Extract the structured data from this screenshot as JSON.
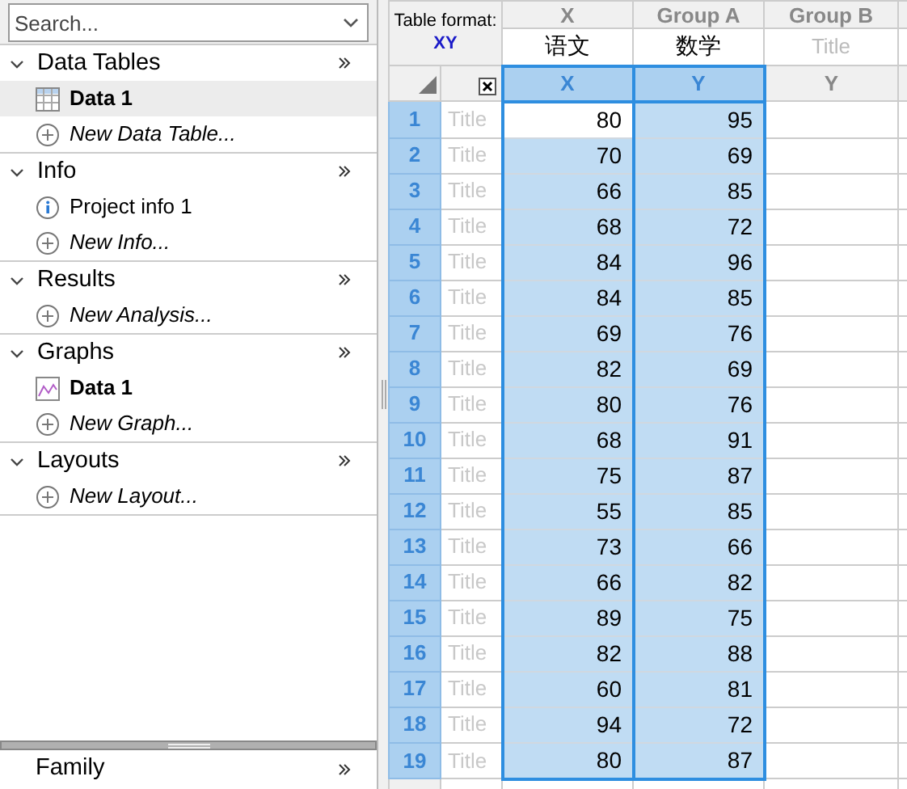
{
  "sidebar": {
    "search": {
      "placeholder": "Search..."
    },
    "sections": [
      {
        "title": "Data Tables",
        "expanded": true,
        "items": [
          {
            "kind": "table",
            "label": "Data 1",
            "selected": true
          },
          {
            "kind": "add",
            "label": "New Data Table...",
            "selected": false
          }
        ]
      },
      {
        "title": "Info",
        "expanded": true,
        "items": [
          {
            "kind": "info",
            "label": "Project info 1",
            "selected": false
          },
          {
            "kind": "add",
            "label": "New Info...",
            "selected": false
          }
        ]
      },
      {
        "title": "Results",
        "expanded": true,
        "items": [
          {
            "kind": "add",
            "label": "New Analysis...",
            "selected": false
          }
        ]
      },
      {
        "title": "Graphs",
        "expanded": true,
        "items": [
          {
            "kind": "graph",
            "label": "Data 1",
            "selected": false
          },
          {
            "kind": "add",
            "label": "New Graph...",
            "selected": false
          }
        ]
      },
      {
        "title": "Layouts",
        "expanded": true,
        "items": [
          {
            "kind": "add",
            "label": "New Layout...",
            "selected": false
          }
        ]
      }
    ],
    "bottom_section": {
      "title": "Family"
    }
  },
  "table": {
    "format_label": "Table format:",
    "format": "XY",
    "columns": [
      {
        "group": "X",
        "title": "语文",
        "title_placeholder": false,
        "subheader": "X",
        "selected": true
      },
      {
        "group": "Group A",
        "title": "数学",
        "title_placeholder": false,
        "subheader": "Y",
        "selected": true
      },
      {
        "group": "Group B",
        "title": "Title",
        "title_placeholder": true,
        "subheader": "Y",
        "selected": false
      }
    ],
    "rows": [
      {
        "number": "1",
        "title": "Title",
        "selected": true,
        "cells": [
          {
            "value": "80",
            "active": true
          },
          {
            "value": "95",
            "active": false
          }
        ]
      },
      {
        "number": "2",
        "title": "Title",
        "selected": true,
        "cells": [
          {
            "value": "70",
            "active": false
          },
          {
            "value": "69",
            "active": false
          }
        ]
      },
      {
        "number": "3",
        "title": "Title",
        "selected": true,
        "cells": [
          {
            "value": "66",
            "active": false
          },
          {
            "value": "85",
            "active": false
          }
        ]
      },
      {
        "number": "4",
        "title": "Title",
        "selected": true,
        "cells": [
          {
            "value": "68",
            "active": false
          },
          {
            "value": "72",
            "active": false
          }
        ]
      },
      {
        "number": "5",
        "title": "Title",
        "selected": true,
        "cells": [
          {
            "value": "84",
            "active": false
          },
          {
            "value": "96",
            "active": false
          }
        ]
      },
      {
        "number": "6",
        "title": "Title",
        "selected": true,
        "cells": [
          {
            "value": "84",
            "active": false
          },
          {
            "value": "85",
            "active": false
          }
        ]
      },
      {
        "number": "7",
        "title": "Title",
        "selected": true,
        "cells": [
          {
            "value": "69",
            "active": false
          },
          {
            "value": "76",
            "active": false
          }
        ]
      },
      {
        "number": "8",
        "title": "Title",
        "selected": true,
        "cells": [
          {
            "value": "82",
            "active": false
          },
          {
            "value": "69",
            "active": false
          }
        ]
      },
      {
        "number": "9",
        "title": "Title",
        "selected": true,
        "cells": [
          {
            "value": "80",
            "active": false
          },
          {
            "value": "76",
            "active": false
          }
        ]
      },
      {
        "number": "10",
        "title": "Title",
        "selected": true,
        "cells": [
          {
            "value": "68",
            "active": false
          },
          {
            "value": "91",
            "active": false
          }
        ]
      },
      {
        "number": "11",
        "title": "Title",
        "selected": true,
        "cells": [
          {
            "value": "75",
            "active": false
          },
          {
            "value": "87",
            "active": false
          }
        ]
      },
      {
        "number": "12",
        "title": "Title",
        "selected": true,
        "cells": [
          {
            "value": "55",
            "active": false
          },
          {
            "value": "85",
            "active": false
          }
        ]
      },
      {
        "number": "13",
        "title": "Title",
        "selected": true,
        "cells": [
          {
            "value": "73",
            "active": false
          },
          {
            "value": "66",
            "active": false
          }
        ]
      },
      {
        "number": "14",
        "title": "Title",
        "selected": true,
        "cells": [
          {
            "value": "66",
            "active": false
          },
          {
            "value": "82",
            "active": false
          }
        ]
      },
      {
        "number": "15",
        "title": "Title",
        "selected": true,
        "cells": [
          {
            "value": "89",
            "active": false
          },
          {
            "value": "75",
            "active": false
          }
        ]
      },
      {
        "number": "16",
        "title": "Title",
        "selected": true,
        "cells": [
          {
            "value": "82",
            "active": false
          },
          {
            "value": "88",
            "active": false
          }
        ]
      },
      {
        "number": "17",
        "title": "Title",
        "selected": true,
        "cells": [
          {
            "value": "60",
            "active": false
          },
          {
            "value": "81",
            "active": false
          }
        ]
      },
      {
        "number": "18",
        "title": "Title",
        "selected": true,
        "cells": [
          {
            "value": "94",
            "active": false
          },
          {
            "value": "72",
            "active": false
          }
        ]
      },
      {
        "number": "19",
        "title": "Title",
        "selected": true,
        "cells": [
          {
            "value": "80",
            "active": false
          },
          {
            "value": "87",
            "active": false
          }
        ]
      }
    ]
  }
}
